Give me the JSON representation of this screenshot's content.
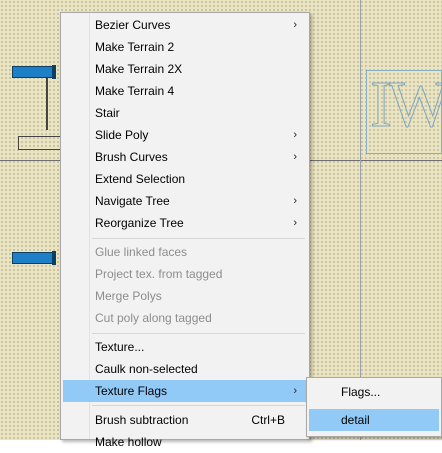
{
  "context_menu": {
    "items": [
      {
        "label": "Bezier Curves",
        "submenu": true
      },
      {
        "label": "Make Terrain 2"
      },
      {
        "label": "Make Terrain 2X"
      },
      {
        "label": "Make Terrain 4"
      },
      {
        "label": "Stair"
      },
      {
        "label": "Slide Poly",
        "submenu": true
      },
      {
        "label": "Brush Curves",
        "submenu": true
      },
      {
        "label": "Extend Selection"
      },
      {
        "label": "Navigate Tree",
        "submenu": true
      },
      {
        "label": "Reorganize Tree",
        "submenu": true
      },
      {
        "label": "Glue linked faces",
        "disabled": true
      },
      {
        "label": "Project tex. from tagged",
        "disabled": true
      },
      {
        "label": "Merge Polys",
        "disabled": true
      },
      {
        "label": "Cut poly along tagged",
        "disabled": true
      },
      {
        "label": "Texture..."
      },
      {
        "label": "Caulk non-selected"
      },
      {
        "label": "Texture Flags",
        "submenu": true,
        "highlighted": true
      },
      {
        "label": "Brush subtraction",
        "shortcut": "Ctrl+B"
      },
      {
        "label": "Make hollow"
      }
    ],
    "submenu_arrow": "›"
  },
  "texture_flags_submenu": {
    "items": [
      {
        "label": "Flags..."
      },
      {
        "label": "detail",
        "highlighted": true
      }
    ]
  },
  "viewport": {
    "background_color": "#ebe4c0",
    "entity_color": "#1d7fc6",
    "highlight_color": "#91c9f7"
  }
}
